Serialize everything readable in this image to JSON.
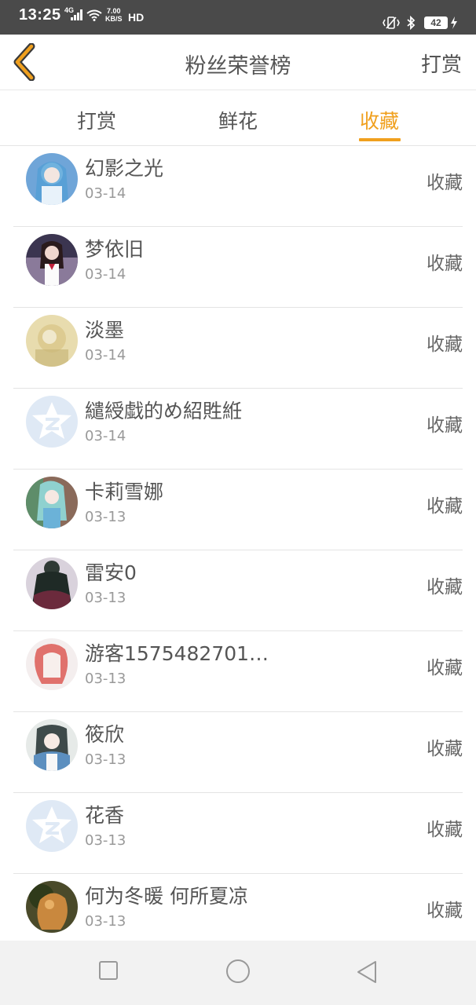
{
  "status_bar": {
    "time": "13:25",
    "network": "4G",
    "speed_value": "7.00",
    "speed_unit": "KB/S",
    "hd": "HD",
    "battery": "42"
  },
  "header": {
    "title": "粉丝荣誉榜",
    "action_label": "打赏",
    "back_icon": "chevron-left-icon",
    "accent_color": "#f0a01e"
  },
  "tabs": [
    {
      "label": "打赏",
      "active": false
    },
    {
      "label": "鲜花",
      "active": false
    },
    {
      "label": "收藏",
      "active": true
    }
  ],
  "fans": [
    {
      "name": "幻影之光",
      "date": "03-14",
      "action": "收藏",
      "avatar": "anime-girl-blue"
    },
    {
      "name": "梦依旧",
      "date": "03-14",
      "action": "收藏",
      "avatar": "anime-girl-dark"
    },
    {
      "name": "淡墨",
      "date": "03-14",
      "action": "收藏",
      "avatar": "faded-portrait"
    },
    {
      "name": "繾綬戱的め紹貹絍",
      "date": "03-14",
      "action": "收藏",
      "avatar": "default-qq"
    },
    {
      "name": "卡莉雪娜",
      "date": "03-13",
      "action": "收藏",
      "avatar": "anime-girl-teal"
    },
    {
      "name": "雷安0",
      "date": "03-13",
      "action": "收藏",
      "avatar": "gothic-figure"
    },
    {
      "name": "游客1575482701…",
      "date": "03-13",
      "action": "收藏",
      "avatar": "red-hair-sketch"
    },
    {
      "name": "筱欣",
      "date": "03-13",
      "action": "收藏",
      "avatar": "anime-girl-white"
    },
    {
      "name": "花香",
      "date": "03-13",
      "action": "收藏",
      "avatar": "default-qq"
    },
    {
      "name": "何为冬暖 何所夏凉",
      "date": "03-13",
      "action": "收藏",
      "avatar": "pet-photo"
    }
  ],
  "nav_bar": {
    "items": [
      "recent-apps-icon",
      "home-icon",
      "back-icon"
    ]
  }
}
